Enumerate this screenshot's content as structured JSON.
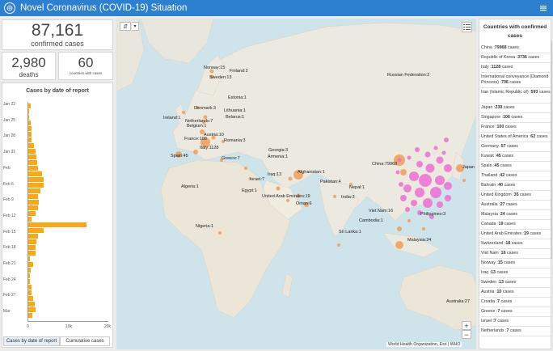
{
  "app": {
    "title": "Novel Coronavirus (COVID-19) Situation"
  },
  "summary": {
    "confirmed_value": "87,161",
    "confirmed_label": "confirmed cases",
    "deaths_value": "2,980",
    "deaths_label": "deaths",
    "countries_value": "60",
    "countries_label": "countries with cases"
  },
  "chart_panel": {
    "title": "Cases by date of report"
  },
  "chart_data": {
    "type": "bar",
    "orientation": "horizontal",
    "title": "Cases by date of report",
    "y_tick_labels": [
      "Jan 22",
      "Jan 25",
      "Jan 28",
      "Jan 31",
      "Feb",
      "Feb 6",
      "Feb 9",
      "Feb 12",
      "Feb 15",
      "Feb 18",
      "Feb 21",
      "Feb 24",
      "Feb 27",
      "Mar"
    ],
    "x_tick_labels": [
      "0",
      "10k",
      "20k"
    ],
    "xlim": [
      0,
      20000
    ],
    "values": [
      550,
      100,
      200,
      650,
      900,
      750,
      900,
      1400,
      1800,
      2000,
      2200,
      2600,
      3600,
      3900,
      3900,
      3100,
      2600,
      2700,
      2500,
      1900,
      800,
      15000,
      4000,
      2500,
      2000,
      1900,
      1800,
      400,
      1200,
      650,
      500,
      400,
      850,
      900,
      1200,
      1600,
      1900,
      1100
    ]
  },
  "tabs": [
    "Cases by date of report",
    "Cumulative cases"
  ],
  "map": {
    "attribution": "World Health Organization, Esri | WHO",
    "zoom_in": "+",
    "zoom_out": "−",
    "labels": [
      {
        "t": "Norway:15"
      },
      {
        "t": "Finland:2"
      },
      {
        "t": "Sweden:13"
      },
      {
        "t": "Estonia:1"
      },
      {
        "t": "Russian Federation:2"
      },
      {
        "t": "Denmark:3"
      },
      {
        "t": "Lithuania:1"
      },
      {
        "t": "Belarus:1"
      },
      {
        "t": "Ireland:1"
      },
      {
        "t": "Netherlands:7"
      },
      {
        "t": "Belgium:1"
      },
      {
        "t": "Austria:10"
      },
      {
        "t": "France:100"
      },
      {
        "t": "Romania:3"
      },
      {
        "t": "Italy:1128"
      },
      {
        "t": "Greece:7"
      },
      {
        "t": "Spain:45"
      },
      {
        "t": "Georgia:3"
      },
      {
        "t": "Armenia:1"
      },
      {
        "t": "Iraq:13"
      },
      {
        "t": "Israel:7"
      },
      {
        "t": "Afghanistan:1"
      },
      {
        "t": "Pakistan:4"
      },
      {
        "t": "Algeria:1"
      },
      {
        "t": "Egypt:1"
      },
      {
        "t": "United Arab Emirates:19"
      },
      {
        "t": "Oman:6"
      },
      {
        "t": "Nepal:1"
      },
      {
        "t": "India:3"
      },
      {
        "t": "China:79968"
      },
      {
        "t": "Japan"
      },
      {
        "t": "Viet Nam:16"
      },
      {
        "t": "Philippines:3"
      },
      {
        "t": "Cambodia:1"
      },
      {
        "t": "Nigeria:1"
      },
      {
        "t": "Sri Lanka:1"
      },
      {
        "t": "Malaysia:24"
      },
      {
        "t": "Australia:27"
      }
    ]
  },
  "country_list": {
    "title": "Countries with confirmed cases",
    "items": [
      {
        "name": "China",
        "count": "79968",
        "suffix": " cases"
      },
      {
        "name": "Republic of Korea",
        "count": "3736",
        "suffix": " cases"
      },
      {
        "name": "Italy",
        "count": "1128",
        "suffix": " cases"
      },
      {
        "name": "International conveyance (Diamond Princess)",
        "count": "706",
        "suffix": " cases"
      },
      {
        "name": "Iran (Islamic Republic of)",
        "count": "593",
        "suffix": " cases"
      },
      {
        "name": "Japan",
        "count": "239",
        "suffix": " cases"
      },
      {
        "name": "Singapore",
        "count": "106",
        "suffix": " cases"
      },
      {
        "name": "France",
        "count": "100",
        "suffix": " cases"
      },
      {
        "name": "United States of America",
        "count": "62",
        "suffix": " cases"
      },
      {
        "name": "Germany",
        "count": "57",
        "suffix": " cases"
      },
      {
        "name": "Kuwait",
        "count": "45",
        "suffix": " cases"
      },
      {
        "name": "Spain",
        "count": "45",
        "suffix": " cases"
      },
      {
        "name": "Thailand",
        "count": "42",
        "suffix": " cases"
      },
      {
        "name": "Bahrain",
        "count": "40",
        "suffix": " cases"
      },
      {
        "name": "United Kingdom",
        "count": "35",
        "suffix": " cases"
      },
      {
        "name": "Australia",
        "count": "27",
        "suffix": " cases"
      },
      {
        "name": "Malaysia",
        "count": "24",
        "suffix": " cases"
      },
      {
        "name": "Canada",
        "count": "19",
        "suffix": " cases"
      },
      {
        "name": "United Arab Emirates",
        "count": "19",
        "suffix": " cases"
      },
      {
        "name": "Switzerland",
        "count": "18",
        "suffix": " cases"
      },
      {
        "name": "Viet Nam",
        "count": "16",
        "suffix": " cases"
      },
      {
        "name": "Norway",
        "count": "15",
        "suffix": " cases"
      },
      {
        "name": "Iraq",
        "count": "13",
        "suffix": " cases"
      },
      {
        "name": "Sweden",
        "count": "13",
        "suffix": " cases"
      },
      {
        "name": "Austria",
        "count": "10",
        "suffix": " cases"
      },
      {
        "name": "Croatia",
        "count": "7",
        "suffix": " cases"
      },
      {
        "name": "Greece",
        "count": "7",
        "suffix": " cases"
      },
      {
        "name": "Israel",
        "count": "7",
        "suffix": " cases"
      },
      {
        "name": "Netherlands",
        "count": "7",
        "suffix": " cases"
      }
    ]
  },
  "colors": {
    "header": "#2d7fd0",
    "bar": "#f7a81b",
    "china_bubble": "#ee6fd2",
    "other_bubble": "#ee9a52"
  }
}
